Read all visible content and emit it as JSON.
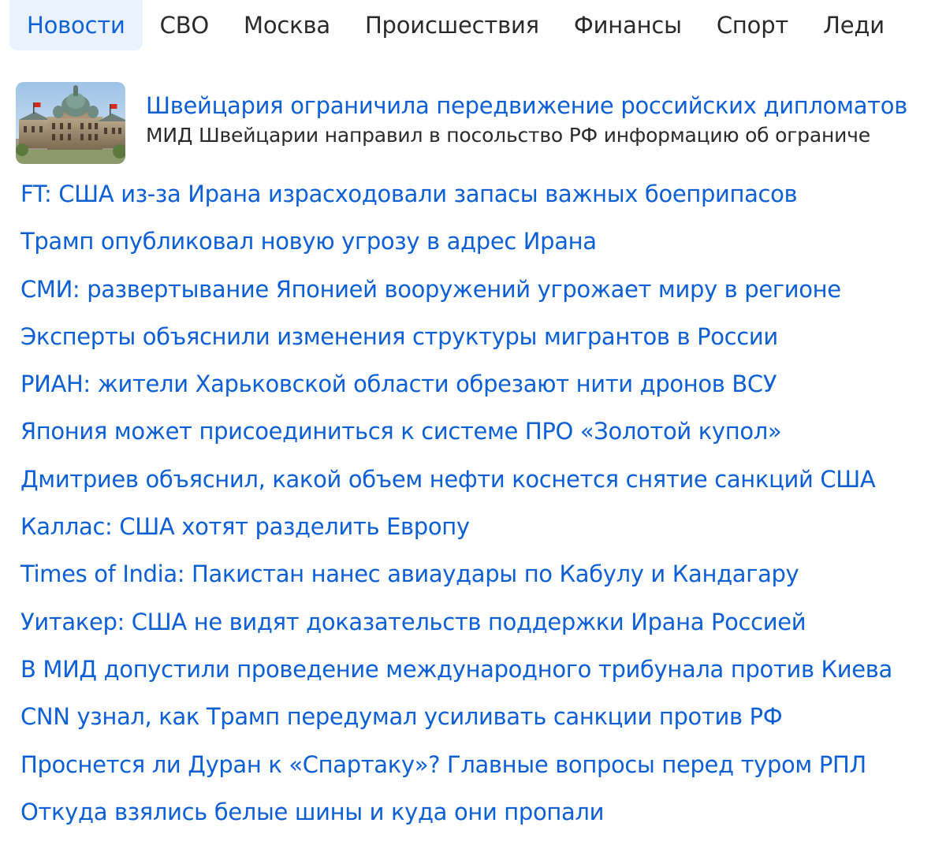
{
  "nav": {
    "tabs": [
      {
        "label": "Новости",
        "active": true
      },
      {
        "label": "СВО",
        "active": false
      },
      {
        "label": "Москва",
        "active": false
      },
      {
        "label": "Происшествия",
        "active": false
      },
      {
        "label": "Финансы",
        "active": false
      },
      {
        "label": "Спорт",
        "active": false
      },
      {
        "label": "Леди",
        "active": false
      }
    ]
  },
  "featured": {
    "title": "Швейцария ограничила передвижение российских дипломатов",
    "snippet": "МИД Швейцарии направил в посольство РФ информацию об ограниче",
    "image": "bern-federal-palace-photo"
  },
  "news": [
    "FT: США из-за Ирана израсходовали запасы важных боеприпасов",
    "Трамп опубликовал новую угрозу в адрес Ирана",
    "СМИ: развертывание Японией вооружений угрожает миру в регионе",
    "Эксперты объяснили изменения структуры мигрантов в России",
    "РИАН: жители Харьковской области обрезают нити дронов ВСУ",
    "Япония может присоединиться к системе ПРО «Золотой купол»",
    "Дмитриев объяснил, какой объем нефти коснется снятие санкций США",
    "Каллас: США хотят разделить Европу",
    "Times of India: Пакистан нанес авиаудары по Кабулу и Кандагару",
    "Уитакер: США не видят доказательств поддержки Ирана Россией",
    "В МИД допустили проведение международного трибунала против Киева",
    "CNN узнал, как Трамп передумал усиливать санкции против РФ",
    "Проснется ли Дуран к «Спартаку»? Главные вопросы перед туром РПЛ",
    "Откуда взялись белые шины и куда они пропали"
  ],
  "colors": {
    "link": "#0d5fd6",
    "active_tab_bg": "#eaf2fd",
    "text": "#2a2a2a"
  }
}
